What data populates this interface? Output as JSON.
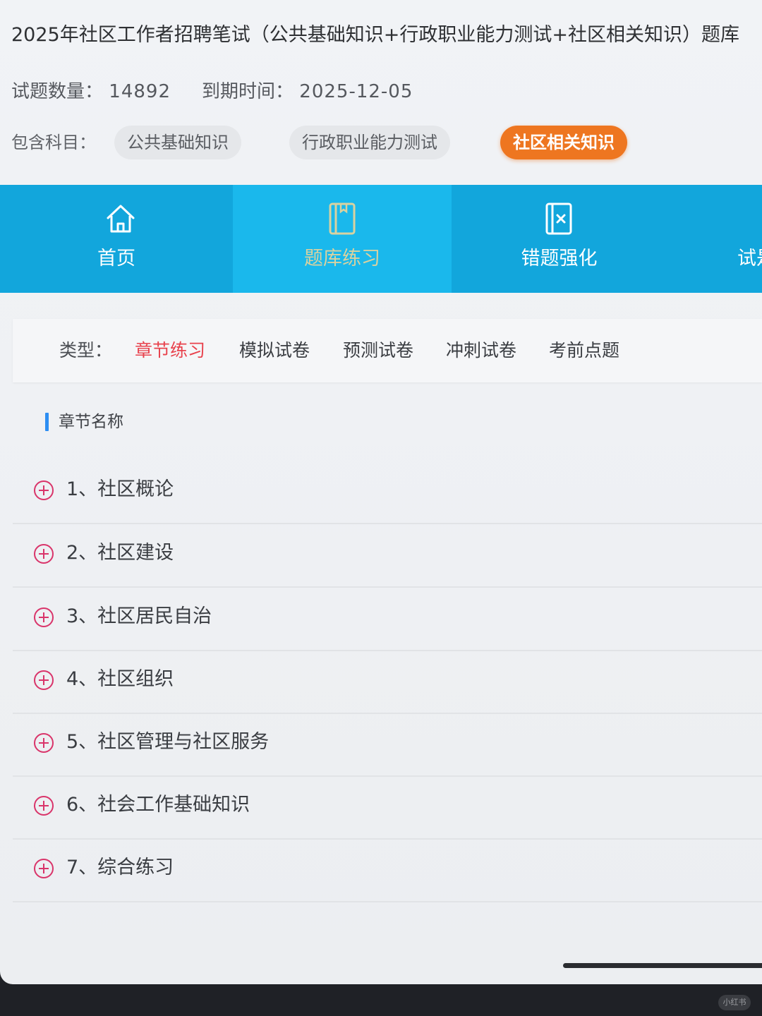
{
  "header": {
    "title": "2025年社区工作者招聘笔试（公共基础知识+行政职业能力测试+社区相关知识）题库",
    "question_count_label": "试题数量：",
    "question_count": "14892",
    "expiry_label": "到期时间：",
    "expiry_date": "2025-12-05",
    "subjects_label": "包含科目：",
    "subjects": [
      {
        "label": "公共基础知识",
        "active": false
      },
      {
        "label": "行政职业能力测试",
        "active": false
      },
      {
        "label": "社区相关知识",
        "active": true
      }
    ]
  },
  "nav": {
    "items": [
      {
        "label": "首页",
        "icon": "home-icon",
        "selected": false
      },
      {
        "label": "题库练习",
        "icon": "book-icon",
        "selected": true
      },
      {
        "label": "错题强化",
        "icon": "wrong-book-icon",
        "selected": false
      },
      {
        "label": "试是",
        "icon": "",
        "selected": false
      }
    ]
  },
  "filter": {
    "type_label": "类型：",
    "options": [
      "章节练习",
      "模拟试卷",
      "预测试卷",
      "冲刺试卷",
      "考前点题"
    ],
    "active_option": "章节练习"
  },
  "chapters": {
    "section_title": "章节名称",
    "items": [
      "1、社区概论",
      "2、社区建设",
      "3、社区居民自治",
      "4、社区组织",
      "5、社区管理与社区服务",
      "6、社会工作基础知识",
      "7、综合练习"
    ]
  },
  "watermark": "小红书",
  "colors": {
    "nav_bg": "#12a6dc",
    "nav_selected_bg": "#1ab8ec",
    "active_chip": "#ee7620",
    "active_type": "#e8424d",
    "plus_icon": "#d9346a",
    "section_bar": "#2d8ef2"
  }
}
